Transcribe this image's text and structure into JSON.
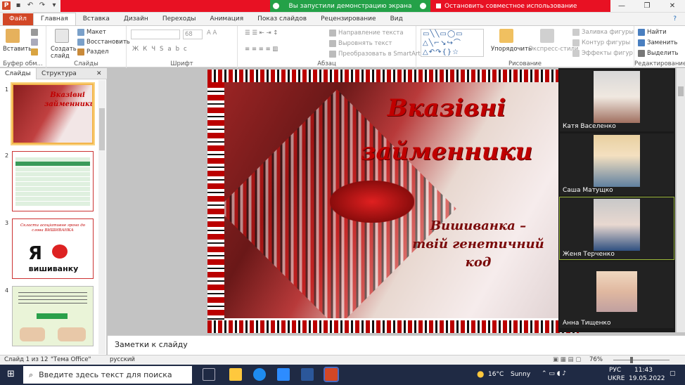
{
  "share": {
    "status": "Вы запустили демонстрацию экрана",
    "stop": "Остановить совместное использование"
  },
  "tabs": [
    "Файл",
    "Главная",
    "Вставка",
    "Дизайн",
    "Переходы",
    "Анимация",
    "Показ слайдов",
    "Рецензирование",
    "Вид"
  ],
  "ribbon": {
    "clipboard": {
      "paste": "Вставить",
      "label": "Буфер обм..."
    },
    "slides": {
      "new_slide": "Создать слайд",
      "layout": "Макет",
      "reset": "Восстановить",
      "section": "Раздел",
      "label": "Слайды"
    },
    "font": {
      "size": "68",
      "label": "Шрифт"
    },
    "paragraph": {
      "text_direction": "Направление текста",
      "align_text": "Выровнять текст",
      "smartart": "Преобразовать в SmartArt",
      "label": "Абзац"
    },
    "drawing": {
      "arrange": "Упорядочить",
      "quick_styles": "Экспресс-стили",
      "fill": "Заливка фигуры",
      "outline": "Контур фигуры",
      "effects": "Эффекты фигур",
      "label": "Рисование"
    },
    "editing": {
      "find": "Найти",
      "replace": "Заменить",
      "select": "Выделить",
      "label": "Редактирование"
    }
  },
  "pane": {
    "tab_slides": "Слайды",
    "tab_outline": "Структура"
  },
  "thumbs": [
    {
      "num": "1",
      "title": "Вказівні займенники"
    },
    {
      "num": "2",
      "title": ""
    },
    {
      "num": "3",
      "title": "Скласти асоціативне гроно до слова ВИШИВАНКА",
      "big": "Я",
      "word": "вишиванку"
    },
    {
      "num": "4",
      "title": ""
    }
  ],
  "slide": {
    "title": "Вказівні займенники",
    "subtitle_l1": "Вишиванка –",
    "subtitle_l2": "твій генетичний код"
  },
  "participants": [
    {
      "name": "Катя Васеленко"
    },
    {
      "name": "Саша Матущко"
    },
    {
      "name": "Женя Терченко"
    },
    {
      "name": "Анна Тищенко"
    }
  ],
  "notes_placeholder": "Заметки к слайду",
  "status": {
    "slide": "Слайд 1 из 12",
    "theme": "\"Тема Office\"",
    "lang": "русский",
    "zoom": "76%"
  },
  "taskbar": {
    "search": "Введите здесь текст для поиска",
    "weather_temp": "16°C",
    "weather_desc": "Sunny",
    "lang1": "РУС",
    "lang2": "UKRE",
    "time": "11:43",
    "date": "19.05.2022"
  },
  "colors": {
    "accent": "#d24726",
    "share_red": "#e81123",
    "share_green": "#24a148",
    "title_red": "#c00000"
  }
}
